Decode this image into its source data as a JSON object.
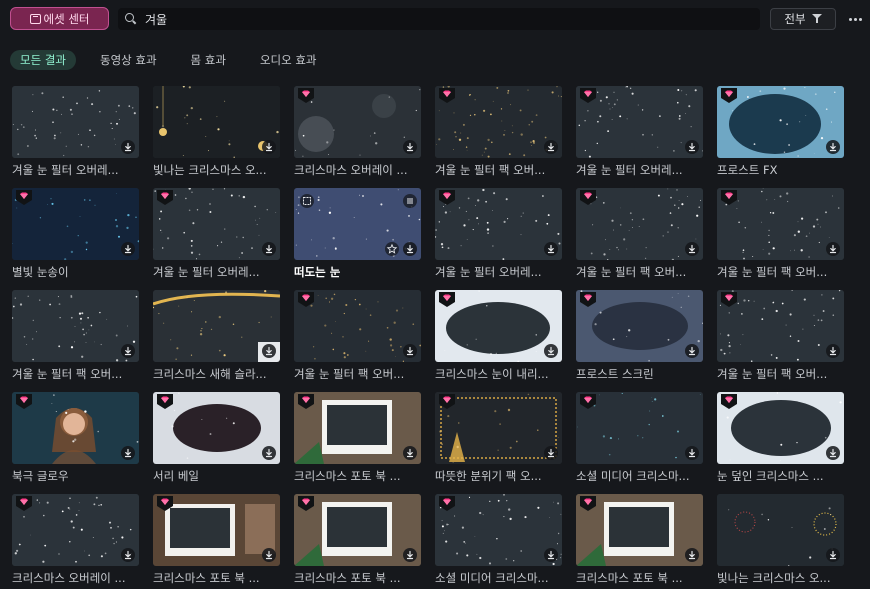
{
  "topbar": {
    "asset_center_label": "에셋 센터",
    "search_value": "겨울",
    "filter_label": "전부"
  },
  "tabs": [
    {
      "label": "모든 결과",
      "active": true
    },
    {
      "label": "동영상 효과",
      "active": false
    },
    {
      "label": "몸 효과",
      "active": false
    },
    {
      "label": "오디오 효과",
      "active": false
    }
  ],
  "colors": {
    "accent": "#8ff0cf",
    "asset_button": "#7a2550",
    "premium_gem": "#ff3d8b"
  },
  "items": [
    {
      "title": "겨울 눈 필터 오버레...",
      "premium": false,
      "style": "snow"
    },
    {
      "title": "빛나는 크리스마스 오...",
      "premium": false,
      "style": "ornament"
    },
    {
      "title": "크리스마스 오버레이 ...",
      "premium": true,
      "style": "bokeh"
    },
    {
      "title": "겨울 눈 필터 팩 오버...",
      "premium": true,
      "style": "gold"
    },
    {
      "title": "겨울 눈 필터 오버레...",
      "premium": true,
      "style": "snow"
    },
    {
      "title": "프로스트 FX",
      "premium": true,
      "style": "frost-blue"
    },
    {
      "title": "별빛 눈송이",
      "premium": true,
      "style": "starlight"
    },
    {
      "title": "겨울 눈 필터 오버레...",
      "premium": true,
      "style": "snow"
    },
    {
      "title": "떠도는 눈",
      "premium": false,
      "style": "blue",
      "selected": true
    },
    {
      "title": "겨울 눈 필터 오버레...",
      "premium": true,
      "style": "snow"
    },
    {
      "title": "겨울 눈 필터 팩 오버...",
      "premium": true,
      "style": "snow"
    },
    {
      "title": "겨울 눈 필터 팩 오버...",
      "premium": true,
      "style": "snow"
    },
    {
      "title": "겨울 눈 필터 팩 오버...",
      "premium": false,
      "style": "snow"
    },
    {
      "title": "크리스마스 새해 슬라...",
      "premium": false,
      "style": "golden-lights"
    },
    {
      "title": "겨울 눈 필터 팩 오버...",
      "premium": true,
      "style": "gold-dust"
    },
    {
      "title": "크리스마스 눈이 내리...",
      "premium": true,
      "style": "frost-frame"
    },
    {
      "title": "프로스트 스크린",
      "premium": true,
      "style": "frost-screen"
    },
    {
      "title": "겨울 눈 필터 팩 오버...",
      "premium": true,
      "style": "snow"
    },
    {
      "title": "북극 글로우",
      "premium": true,
      "style": "portrait"
    },
    {
      "title": "서리 베일",
      "premium": true,
      "style": "frost-veil"
    },
    {
      "title": "크리스마스 포토 북 ...",
      "premium": true,
      "style": "photo"
    },
    {
      "title": "따뜻한 분위기 팩 오...",
      "premium": true,
      "style": "warm"
    },
    {
      "title": "소셜 미디어 크리스마...",
      "premium": true,
      "style": "flakes"
    },
    {
      "title": "눈 덮인 크리스마스 ...",
      "premium": true,
      "style": "snow-frame"
    },
    {
      "title": "크리스마스 오버레이 ...",
      "premium": true,
      "style": "snow"
    },
    {
      "title": "크리스마스 포토 북 ...",
      "premium": true,
      "style": "photo2"
    },
    {
      "title": "크리스마스 포토 북 ...",
      "premium": true,
      "style": "photo"
    },
    {
      "title": "소셜 미디어 크리스마...",
      "premium": true,
      "style": "snow"
    },
    {
      "title": "크리스마스 포토 북 ...",
      "premium": true,
      "style": "photo"
    },
    {
      "title": "빛나는 크리스마스 오...",
      "premium": false,
      "style": "fireworks"
    }
  ]
}
